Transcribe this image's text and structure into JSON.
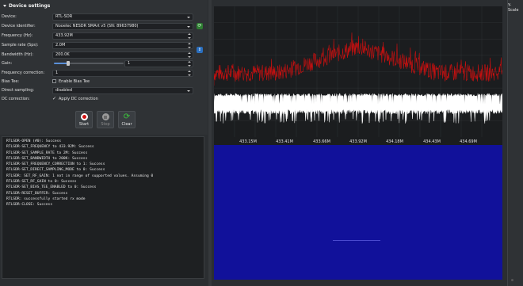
{
  "settings": {
    "section_title": "Device settings",
    "device": {
      "label": "Device:",
      "value": "RTL-SDR"
    },
    "identifier": {
      "label": "Device identifier:",
      "value": "Nooelec NESDR SMArt v5 (SN: 89637980)"
    },
    "frequency": {
      "label": "Frequency (Hz):",
      "value": "433.92M"
    },
    "sample_rate": {
      "label": "Sample rate (Sps):",
      "value": "2.0M"
    },
    "bandwidth": {
      "label": "Bandwidth (Hz):",
      "value": "200.0K"
    },
    "gain": {
      "label": "Gain:",
      "value": "1"
    },
    "freq_correction": {
      "label": "Frequency correction:",
      "value": "1"
    },
    "bias_tee": {
      "label": "Bias Tee:",
      "checkbox_label": "Enable Bias Tee",
      "checked": false
    },
    "direct_sampling": {
      "label": "Direct sampling:",
      "value": "disabled"
    },
    "dc_correction": {
      "label": "DC correction:",
      "checkbox_label": "Apply DC correction",
      "checked": true
    }
  },
  "actions": {
    "start": "Start",
    "stop": "Stop",
    "clear": "Clear"
  },
  "log": [
    "RTLSDR-OPEN (#0): Success",
    "RTLSDR-SET_FREQUENCY to 433.92M: Success",
    "RTLSDR-SET_SAMPLE_RATE to 2M: Success",
    "RTLSDR-SET_BANDWIDTH to 200K: Success",
    "RTLSDR-SET_FREQUENCY_CORRECTION to 1: Success",
    "RTLSDR-SET_DIRECT_SAMPLING_MODE to 0: Success",
    "RTLSDR: SET_RF_GAIN: 1 not in range of supported values. Assuming 0",
    "RTLSDR-SET_RF_GAIN to 0: Success",
    "RTLSDR-SET_BIAS_TEE_ENABLED to 0: Success",
    "RTLSDR-RESET_BUFFER: Success",
    "RTLSDR: successfully started rx mode",
    "RTLSDR-CLOSE: Success"
  ],
  "spectrum": {
    "freq_labels": [
      "433.15M",
      "433.41M",
      "433.66M",
      "433.92M",
      "434.18M",
      "434.43M",
      "434.69M"
    ],
    "trace_color": "#c81010",
    "waterfall_color": "#11119a"
  },
  "right_panel": {
    "yscale_label": "Y-Scale"
  }
}
